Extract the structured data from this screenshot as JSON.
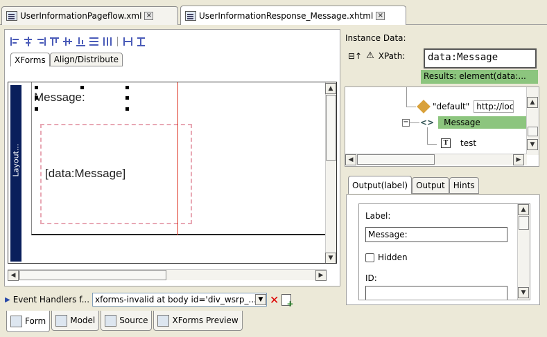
{
  "editor_tabs": [
    {
      "label": "UserInformationPageflow.xml",
      "active": false
    },
    {
      "label": "UserInformationResponse_Message.xhtml",
      "active": true
    }
  ],
  "design": {
    "subtabs": [
      "XForms",
      "Align/Distribute"
    ],
    "layout_label": "Layout...",
    "message_label": "Message:",
    "data_binding": "[data:Message]"
  },
  "event_row": {
    "label": "Event Handlers f...",
    "selected": "xforms-invalid at body id='div_wsrp_..."
  },
  "bottom_tabs": [
    {
      "label": "Form",
      "icon": "form-icon"
    },
    {
      "label": "Model",
      "icon": "model-icon"
    },
    {
      "label": "Source",
      "icon": "source-icon"
    },
    {
      "label": "XForms Preview",
      "icon": "preview-icon"
    }
  ],
  "instance": {
    "title": "Instance Data:",
    "xpath_label": "XPath:",
    "xpath_value": "data:Message",
    "results": "Results: element(data:...",
    "tree": {
      "ns_label": "\"default\"",
      "ns_url": "http://loca",
      "element": "Message",
      "text_node": "test"
    }
  },
  "props": {
    "tabs": [
      "Output(label)",
      "Output",
      "Hints"
    ],
    "label_caption": "Label:",
    "label_value": "Message:",
    "hidden_caption": "Hidden",
    "id_caption": "ID:"
  },
  "colors": {
    "selection_green": "#8cc57e",
    "layout_navy": "#0a1f5c"
  }
}
